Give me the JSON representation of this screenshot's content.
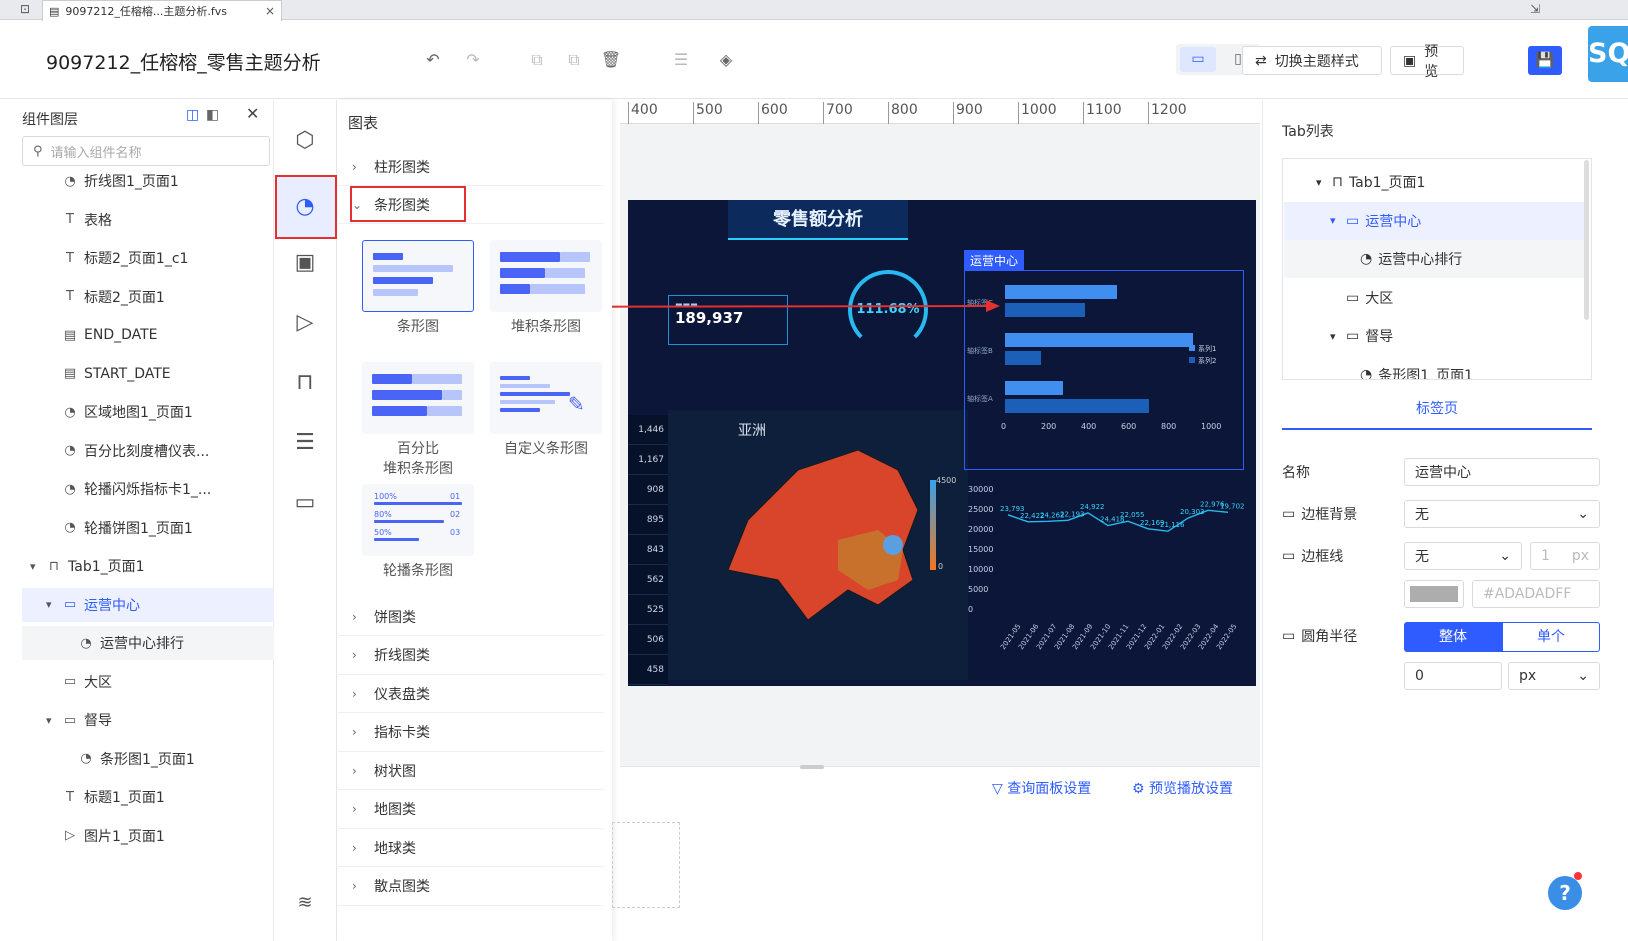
{
  "titlebar": {
    "tab_title": "9097212_任榕榕...主题分析.fvs",
    "close": "×"
  },
  "header": {
    "title": "9097212_任榕榕_零售主题分析",
    "switch_theme_label": "切换主题样式",
    "preview_label": "预览",
    "sql_badge": "SQL"
  },
  "layers": {
    "title": "组件图层",
    "search_placeholder": "请输入组件名称",
    "items": [
      {
        "label": "折线图1_页面1",
        "icon": "chart-icon"
      },
      {
        "label": "表格",
        "icon": "text-icon"
      },
      {
        "label": "标题2_页面1_c1",
        "icon": "text-icon"
      },
      {
        "label": "标题2_页面1",
        "icon": "text-icon"
      },
      {
        "label": "END_DATE",
        "icon": "param-icon"
      },
      {
        "label": "START_DATE",
        "icon": "param-icon"
      },
      {
        "label": "区域地图1_页面1",
        "icon": "chart-icon"
      },
      {
        "label": "百分比刻度槽仪表...",
        "icon": "chart-icon"
      },
      {
        "label": "轮播闪烁指标卡1_...",
        "icon": "chart-icon"
      },
      {
        "label": "轮播饼图1_页面1",
        "icon": "chart-icon"
      },
      {
        "label": "Tab1_页面1",
        "icon": "tab-icon"
      },
      {
        "label": "运营中心",
        "icon": "folder-icon"
      },
      {
        "label": "运营中心排行",
        "icon": "chart-icon"
      },
      {
        "label": "大区",
        "icon": "folder-icon"
      },
      {
        "label": "督导",
        "icon": "folder-icon"
      },
      {
        "label": "条形图1_页面1",
        "icon": "chart-icon"
      },
      {
        "label": "标题1_页面1",
        "icon": "text-icon"
      },
      {
        "label": "图片1_页面1",
        "icon": "image-icon"
      }
    ]
  },
  "ruler": {
    "ticks": [
      "400",
      "500",
      "600",
      "700",
      "800",
      "900",
      "1000",
      "1100",
      "1200"
    ]
  },
  "chart_panel": {
    "title": "图表",
    "categories_top": [
      "柱形图类",
      "条形图类"
    ],
    "tiles": [
      "条形图",
      "堆积条形图",
      "百分比\n堆积条形图",
      "自定义条形图",
      "轮播条形图"
    ],
    "percent_tile_line1": "百分比",
    "percent_tile_line2": "堆积条形图",
    "carousel_labels": [
      "100%",
      "80%",
      "50%",
      "01",
      "02",
      "03"
    ],
    "categories_bottom": [
      "饼图类",
      "折线图类",
      "仪表盘类",
      "指标卡类",
      "树状图",
      "地图类",
      "地球类",
      "散点图类"
    ]
  },
  "dashboard": {
    "title": "零售额分析",
    "kpi_value": "189,937",
    "gauge_value": "111.68%",
    "tab_label": "运营中心",
    "map_label": "亚洲",
    "map_legend_max": "4500",
    "map_legend_min": "0",
    "left_values": [
      "1,446",
      "1,167",
      "908",
      "895",
      "843",
      "562",
      "525",
      "506",
      "458"
    ],
    "bar_axis": [
      "0",
      "200",
      "400",
      "600",
      "800",
      "1000"
    ],
    "bar_categories": [
      "轴标签C",
      "轴标签B",
      "轴标签A"
    ],
    "bar_series": [
      "系列1",
      "系列2"
    ],
    "line_y_axis": [
      "30000",
      "25000",
      "20000",
      "15000",
      "10000",
      "5000",
      "0"
    ],
    "line_labels": [
      "23,793",
      "22,422",
      "24,262",
      "22,193",
      "24,922",
      "24,418",
      "22,055",
      "22,169",
      "21,116",
      "20,303",
      "22,976",
      "19,702"
    ],
    "line_x_axis": [
      "2021-05",
      "2021-06",
      "2021-07",
      "2021-08",
      "2021-09",
      "2021-10",
      "2021-11",
      "2021-12",
      "2022-01",
      "2022-02",
      "2022-03",
      "2022-04",
      "2022-05"
    ]
  },
  "bottom": {
    "query_panel_label": "查询面板设置",
    "preview_play_label": "预览播放设置"
  },
  "right_panel": {
    "tab_list_title": "Tab列表",
    "tree": [
      {
        "label": "Tab1_页面1"
      },
      {
        "label": "运营中心"
      },
      {
        "label": "运营中心排行"
      },
      {
        "label": "大区"
      },
      {
        "label": "督导"
      },
      {
        "label": "条形图1_页面1"
      }
    ],
    "tab_page_label": "标签页",
    "name_label": "名称",
    "name_value": "运营中心",
    "border_bg_label": "边框背景",
    "border_bg_value": "无",
    "border_line_label": "边框线",
    "border_line_value": "无",
    "border_width": "1",
    "border_unit": "px",
    "border_color": "#ADADADFF",
    "radius_label": "圆角半径",
    "radius_whole": "整体",
    "radius_single": "单个",
    "radius_value": "0",
    "radius_unit": "px"
  },
  "help": "?",
  "colors": {
    "accent": "#2f5cff",
    "highlight": "#e62f2f",
    "map_red": "#d9452a"
  }
}
